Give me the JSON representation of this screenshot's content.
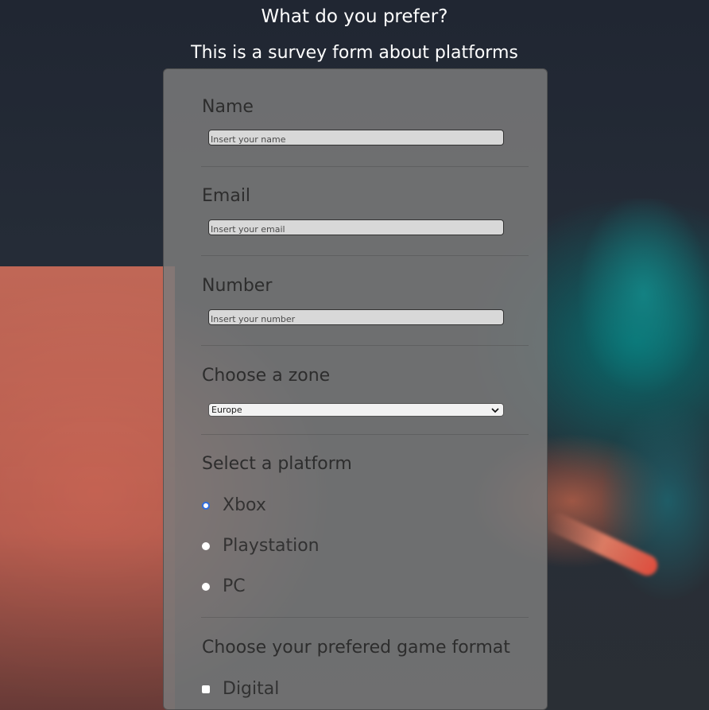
{
  "page": {
    "title": "What do you prefer?",
    "subtitle": "This is a survey form about platforms"
  },
  "form": {
    "name": {
      "label": "Name",
      "placeholder": "Insert your name"
    },
    "email": {
      "label": "Email",
      "placeholder": "Insert your email"
    },
    "number": {
      "label": "Number",
      "placeholder": "Insert your number"
    },
    "zone": {
      "label": "Choose a zone",
      "selected": "Europe"
    },
    "platform": {
      "label": "Select a platform",
      "options": [
        {
          "label": "Xbox",
          "selected": true
        },
        {
          "label": "Playstation",
          "selected": false
        },
        {
          "label": "PC",
          "selected": false
        }
      ]
    },
    "format": {
      "label": "Choose your prefered game format",
      "options": [
        {
          "label": "Digital",
          "checked": false
        }
      ]
    }
  },
  "colors": {
    "panel": "#7a7a7a",
    "radio_selected": "#2f6ddf"
  },
  "icons": {
    "zone_select": "chevron-down-icon",
    "radio_selected": "radio-selected-icon",
    "radio": "radio-icon",
    "checkbox": "checkbox-icon"
  }
}
